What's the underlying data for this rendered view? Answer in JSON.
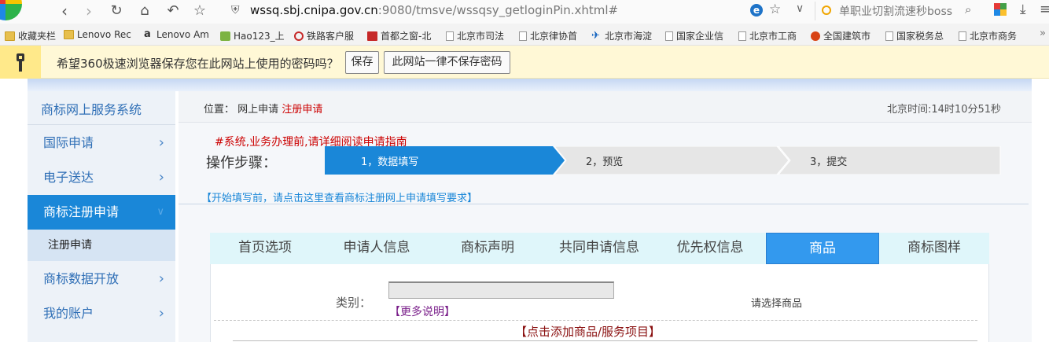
{
  "browser": {
    "url_host": "wssq.sbj.cnipa.gov.cn",
    "url_path": ":9080/tmsve/wssqsy_getloginPin.xhtml#",
    "search_text": "单职业切割流速秒boss"
  },
  "bookmarks": [
    {
      "label": "收藏夹栏",
      "icon": "folder"
    },
    {
      "label": "Lenovo Rec",
      "icon": "folder"
    },
    {
      "label": "Lenovo Am",
      "icon": "amazon"
    },
    {
      "label": "Hao123_上",
      "icon": "hao123"
    },
    {
      "label": "铁路客户服",
      "icon": "rail"
    },
    {
      "label": "首都之窗-北",
      "icon": "capital"
    },
    {
      "label": "北京市司法",
      "icon": "page"
    },
    {
      "label": "北京律协首",
      "icon": "page"
    },
    {
      "label": "北京市海淀",
      "icon": "haidian"
    },
    {
      "label": "国家企业信",
      "icon": "page"
    },
    {
      "label": "北京市工商",
      "icon": "page"
    },
    {
      "label": "全国建筑市",
      "icon": "emblem"
    },
    {
      "label": "国家税务总",
      "icon": "page"
    },
    {
      "label": "北京市商务",
      "icon": "page"
    }
  ],
  "password_bar": {
    "message": "希望360极速浏览器保存您在此网站上使用的密码吗？",
    "save": "保存",
    "never": "此网站一律不保存密码"
  },
  "sidebar": {
    "title": "商标网上服务系统",
    "items": [
      {
        "label": "国际申请"
      },
      {
        "label": "电子送达"
      },
      {
        "label": "商标注册申请"
      },
      {
        "label": "注册申请"
      },
      {
        "label": "商标数据开放"
      },
      {
        "label": "我的账户"
      }
    ]
  },
  "breadcrumb": {
    "prefix": "位置：",
    "item1": "网上申请",
    "item2": "注册申请"
  },
  "clock": "北京时间:14时10分51秒",
  "notice": "#系统,业务办理前,请详细阅读申请指南",
  "steps": {
    "label": "操作步骤：",
    "items": [
      "1，数据填写",
      "2，预览",
      "3，提交"
    ]
  },
  "hint_link": "【开始填写前，请点击这里查看商标注册网上申请填写要求】",
  "tabs": [
    "首页选项",
    "申请人信息",
    "商标声明",
    "共同申请信息",
    "优先权信息",
    "商品",
    "商标图样"
  ],
  "form": {
    "category_label": "类别：",
    "more_link": "【更多说明】",
    "select_prompt": "请选择商品",
    "add_link": "【点击添加商品/服务项目】"
  },
  "colors": {
    "accent": "#1a87d8",
    "sidebar_active": "#1a87d8",
    "link_red": "#cc0000",
    "link_blue": "#1a87d8"
  }
}
